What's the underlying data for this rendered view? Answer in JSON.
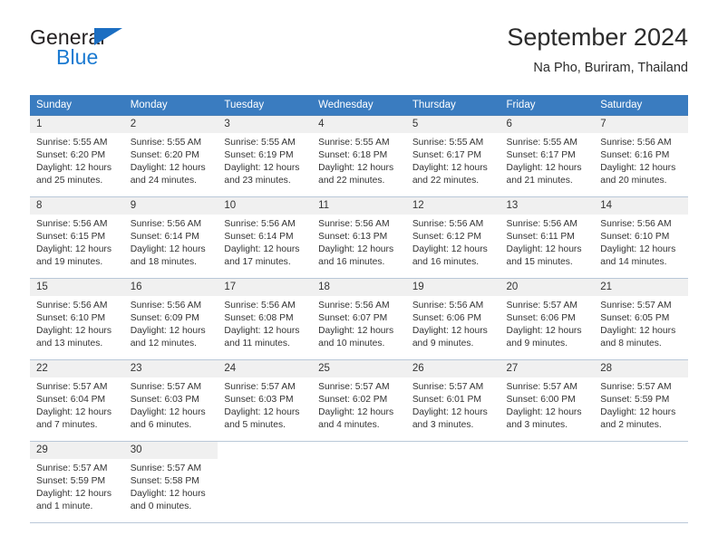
{
  "brand": {
    "name_part1": "General",
    "name_part2": "Blue",
    "logo_icon": "triangle-flag-icon"
  },
  "header": {
    "title": "September 2024",
    "subtitle": "Na Pho, Buriram, Thailand"
  },
  "colors": {
    "header_row_bg": "#3a7cc0",
    "daynum_bg": "#f0f0f0",
    "brand_blue": "#1b7ad1",
    "logo_blue": "#1b6ec2",
    "grid_line": "#b9c8d8",
    "text": "#333333"
  },
  "weekdays": [
    "Sunday",
    "Monday",
    "Tuesday",
    "Wednesday",
    "Thursday",
    "Friday",
    "Saturday"
  ],
  "weeks": [
    [
      {
        "day": "1",
        "sunrise": "Sunrise: 5:55 AM",
        "sunset": "Sunset: 6:20 PM",
        "daylight1": "Daylight: 12 hours",
        "daylight2": "and 25 minutes."
      },
      {
        "day": "2",
        "sunrise": "Sunrise: 5:55 AM",
        "sunset": "Sunset: 6:20 PM",
        "daylight1": "Daylight: 12 hours",
        "daylight2": "and 24 minutes."
      },
      {
        "day": "3",
        "sunrise": "Sunrise: 5:55 AM",
        "sunset": "Sunset: 6:19 PM",
        "daylight1": "Daylight: 12 hours",
        "daylight2": "and 23 minutes."
      },
      {
        "day": "4",
        "sunrise": "Sunrise: 5:55 AM",
        "sunset": "Sunset: 6:18 PM",
        "daylight1": "Daylight: 12 hours",
        "daylight2": "and 22 minutes."
      },
      {
        "day": "5",
        "sunrise": "Sunrise: 5:55 AM",
        "sunset": "Sunset: 6:17 PM",
        "daylight1": "Daylight: 12 hours",
        "daylight2": "and 22 minutes."
      },
      {
        "day": "6",
        "sunrise": "Sunrise: 5:55 AM",
        "sunset": "Sunset: 6:17 PM",
        "daylight1": "Daylight: 12 hours",
        "daylight2": "and 21 minutes."
      },
      {
        "day": "7",
        "sunrise": "Sunrise: 5:56 AM",
        "sunset": "Sunset: 6:16 PM",
        "daylight1": "Daylight: 12 hours",
        "daylight2": "and 20 minutes."
      }
    ],
    [
      {
        "day": "8",
        "sunrise": "Sunrise: 5:56 AM",
        "sunset": "Sunset: 6:15 PM",
        "daylight1": "Daylight: 12 hours",
        "daylight2": "and 19 minutes."
      },
      {
        "day": "9",
        "sunrise": "Sunrise: 5:56 AM",
        "sunset": "Sunset: 6:14 PM",
        "daylight1": "Daylight: 12 hours",
        "daylight2": "and 18 minutes."
      },
      {
        "day": "10",
        "sunrise": "Sunrise: 5:56 AM",
        "sunset": "Sunset: 6:14 PM",
        "daylight1": "Daylight: 12 hours",
        "daylight2": "and 17 minutes."
      },
      {
        "day": "11",
        "sunrise": "Sunrise: 5:56 AM",
        "sunset": "Sunset: 6:13 PM",
        "daylight1": "Daylight: 12 hours",
        "daylight2": "and 16 minutes."
      },
      {
        "day": "12",
        "sunrise": "Sunrise: 5:56 AM",
        "sunset": "Sunset: 6:12 PM",
        "daylight1": "Daylight: 12 hours",
        "daylight2": "and 16 minutes."
      },
      {
        "day": "13",
        "sunrise": "Sunrise: 5:56 AM",
        "sunset": "Sunset: 6:11 PM",
        "daylight1": "Daylight: 12 hours",
        "daylight2": "and 15 minutes."
      },
      {
        "day": "14",
        "sunrise": "Sunrise: 5:56 AM",
        "sunset": "Sunset: 6:10 PM",
        "daylight1": "Daylight: 12 hours",
        "daylight2": "and 14 minutes."
      }
    ],
    [
      {
        "day": "15",
        "sunrise": "Sunrise: 5:56 AM",
        "sunset": "Sunset: 6:10 PM",
        "daylight1": "Daylight: 12 hours",
        "daylight2": "and 13 minutes."
      },
      {
        "day": "16",
        "sunrise": "Sunrise: 5:56 AM",
        "sunset": "Sunset: 6:09 PM",
        "daylight1": "Daylight: 12 hours",
        "daylight2": "and 12 minutes."
      },
      {
        "day": "17",
        "sunrise": "Sunrise: 5:56 AM",
        "sunset": "Sunset: 6:08 PM",
        "daylight1": "Daylight: 12 hours",
        "daylight2": "and 11 minutes."
      },
      {
        "day": "18",
        "sunrise": "Sunrise: 5:56 AM",
        "sunset": "Sunset: 6:07 PM",
        "daylight1": "Daylight: 12 hours",
        "daylight2": "and 10 minutes."
      },
      {
        "day": "19",
        "sunrise": "Sunrise: 5:56 AM",
        "sunset": "Sunset: 6:06 PM",
        "daylight1": "Daylight: 12 hours",
        "daylight2": "and 9 minutes."
      },
      {
        "day": "20",
        "sunrise": "Sunrise: 5:57 AM",
        "sunset": "Sunset: 6:06 PM",
        "daylight1": "Daylight: 12 hours",
        "daylight2": "and 9 minutes."
      },
      {
        "day": "21",
        "sunrise": "Sunrise: 5:57 AM",
        "sunset": "Sunset: 6:05 PM",
        "daylight1": "Daylight: 12 hours",
        "daylight2": "and 8 minutes."
      }
    ],
    [
      {
        "day": "22",
        "sunrise": "Sunrise: 5:57 AM",
        "sunset": "Sunset: 6:04 PM",
        "daylight1": "Daylight: 12 hours",
        "daylight2": "and 7 minutes."
      },
      {
        "day": "23",
        "sunrise": "Sunrise: 5:57 AM",
        "sunset": "Sunset: 6:03 PM",
        "daylight1": "Daylight: 12 hours",
        "daylight2": "and 6 minutes."
      },
      {
        "day": "24",
        "sunrise": "Sunrise: 5:57 AM",
        "sunset": "Sunset: 6:03 PM",
        "daylight1": "Daylight: 12 hours",
        "daylight2": "and 5 minutes."
      },
      {
        "day": "25",
        "sunrise": "Sunrise: 5:57 AM",
        "sunset": "Sunset: 6:02 PM",
        "daylight1": "Daylight: 12 hours",
        "daylight2": "and 4 minutes."
      },
      {
        "day": "26",
        "sunrise": "Sunrise: 5:57 AM",
        "sunset": "Sunset: 6:01 PM",
        "daylight1": "Daylight: 12 hours",
        "daylight2": "and 3 minutes."
      },
      {
        "day": "27",
        "sunrise": "Sunrise: 5:57 AM",
        "sunset": "Sunset: 6:00 PM",
        "daylight1": "Daylight: 12 hours",
        "daylight2": "and 3 minutes."
      },
      {
        "day": "28",
        "sunrise": "Sunrise: 5:57 AM",
        "sunset": "Sunset: 5:59 PM",
        "daylight1": "Daylight: 12 hours",
        "daylight2": "and 2 minutes."
      }
    ],
    [
      {
        "day": "29",
        "sunrise": "Sunrise: 5:57 AM",
        "sunset": "Sunset: 5:59 PM",
        "daylight1": "Daylight: 12 hours",
        "daylight2": "and 1 minute."
      },
      {
        "day": "30",
        "sunrise": "Sunrise: 5:57 AM",
        "sunset": "Sunset: 5:58 PM",
        "daylight1": "Daylight: 12 hours",
        "daylight2": "and 0 minutes."
      },
      {
        "day": "",
        "sunrise": "",
        "sunset": "",
        "daylight1": "",
        "daylight2": ""
      },
      {
        "day": "",
        "sunrise": "",
        "sunset": "",
        "daylight1": "",
        "daylight2": ""
      },
      {
        "day": "",
        "sunrise": "",
        "sunset": "",
        "daylight1": "",
        "daylight2": ""
      },
      {
        "day": "",
        "sunrise": "",
        "sunset": "",
        "daylight1": "",
        "daylight2": ""
      },
      {
        "day": "",
        "sunrise": "",
        "sunset": "",
        "daylight1": "",
        "daylight2": ""
      }
    ]
  ]
}
